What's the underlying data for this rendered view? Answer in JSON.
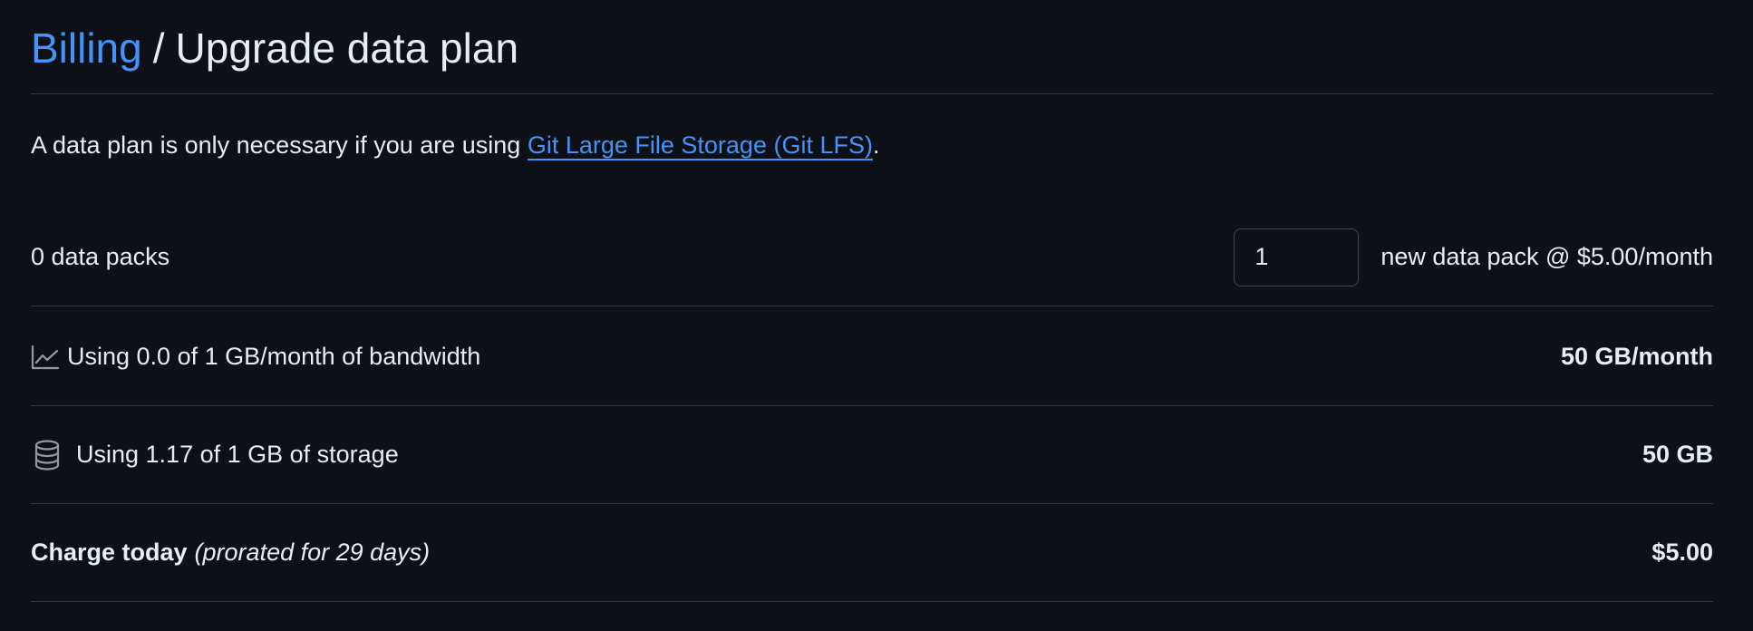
{
  "breadcrumb": {
    "parent_label": "Billing",
    "separator": "/",
    "current_label": "Upgrade data plan"
  },
  "intro": {
    "text_before": "A data plan is only necessary if you are using ",
    "link_label": "Git Large File Storage (Git LFS)",
    "text_after": "."
  },
  "packs": {
    "current_label": "0 data packs",
    "quantity_value": "1",
    "price_label": "new data pack @ $5.00/month"
  },
  "bandwidth": {
    "icon": "graph-icon",
    "usage_label": "Using 0.0 of 1 GB/month of bandwidth",
    "new_total": "50 GB/month"
  },
  "storage": {
    "icon": "database-icon",
    "usage_label": "Using 1.17 of 1 GB of storage",
    "new_total": "50 GB"
  },
  "charge": {
    "label": "Charge today",
    "note": "(prorated for 29 days)",
    "amount": "$5.00"
  },
  "colors": {
    "background": "#0d1117",
    "text": "#e6edf3",
    "link": "#4493f8",
    "border": "#30363d",
    "muted_icon": "#9198a1"
  }
}
